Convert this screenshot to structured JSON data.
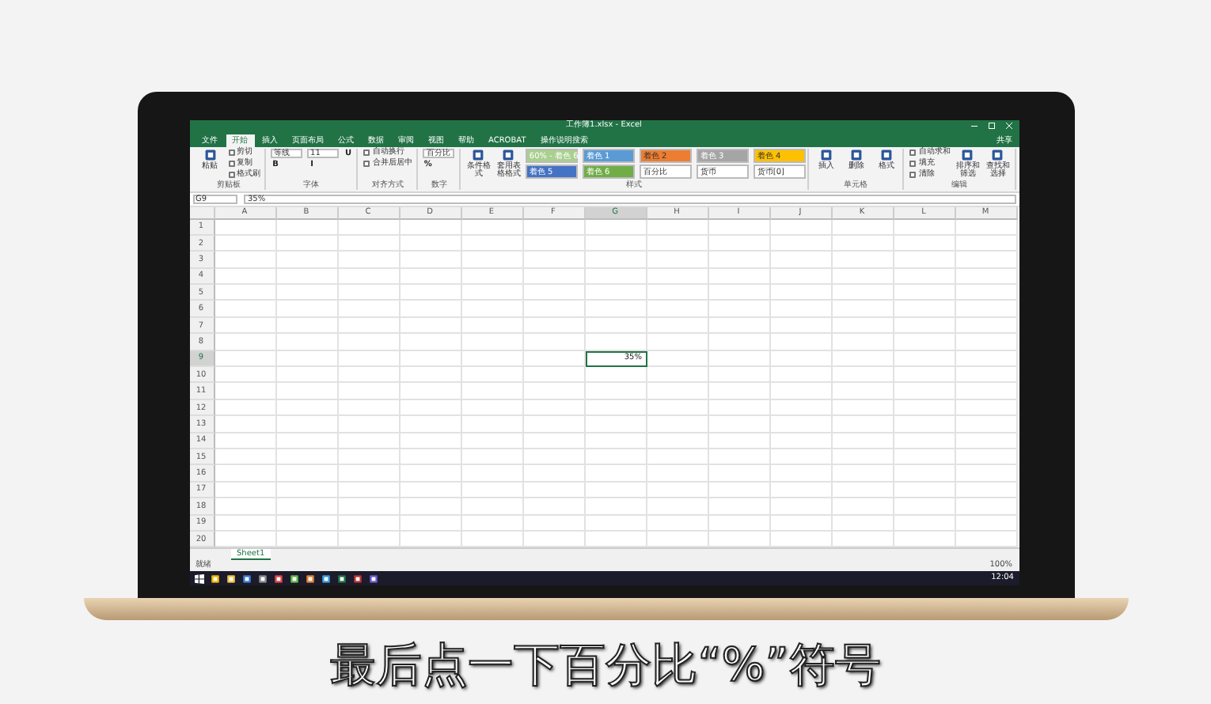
{
  "window": {
    "title": "工作簿1.xlsx - Excel",
    "share": "共享"
  },
  "ribbon_tabs": [
    {
      "label": "文件",
      "selected": false
    },
    {
      "label": "开始",
      "selected": true
    },
    {
      "label": "插入",
      "selected": false
    },
    {
      "label": "页面布局",
      "selected": false
    },
    {
      "label": "公式",
      "selected": false
    },
    {
      "label": "数据",
      "selected": false
    },
    {
      "label": "审阅",
      "selected": false
    },
    {
      "label": "视图",
      "selected": false
    },
    {
      "label": "帮助",
      "selected": false
    },
    {
      "label": "ACROBAT",
      "selected": false
    }
  ],
  "tell_me": "操作说明搜索",
  "ribbon_groups": [
    {
      "label": "剪贴板",
      "items": [
        {
          "kind": "large",
          "label": "粘贴"
        },
        {
          "kind": "small",
          "label": "剪切"
        },
        {
          "kind": "small",
          "label": "复制"
        },
        {
          "kind": "small",
          "label": "格式刷"
        }
      ]
    },
    {
      "label": "字体",
      "items": [
        {
          "kind": "field",
          "label": "等线"
        },
        {
          "kind": "glyph",
          "label": "B"
        },
        {
          "kind": "field",
          "label": "11"
        },
        {
          "kind": "glyph",
          "label": "I"
        },
        {
          "kind": "glyph",
          "label": "U"
        }
      ]
    },
    {
      "label": "对齐方式",
      "items": [
        {
          "kind": "small",
          "label": "自动换行"
        },
        {
          "kind": "small",
          "label": "合并后居中"
        }
      ]
    },
    {
      "label": "数字",
      "items": [
        {
          "kind": "field",
          "label": "百分比"
        },
        {
          "kind": "glyph",
          "label": "%"
        }
      ]
    },
    {
      "label": "样式",
      "items": [
        {
          "kind": "large",
          "label": "条件格式"
        },
        {
          "kind": "large",
          "label": "套用表格格式"
        },
        {
          "kind": "chip",
          "label": "60% - 着色 6",
          "color": "#a9d08e"
        },
        {
          "kind": "chip",
          "label": "着色 5",
          "color": "#4472c4"
        },
        {
          "kind": "chip",
          "label": "着色 1",
          "color": "#5b9bd5"
        },
        {
          "kind": "chip",
          "label": "着色 6",
          "color": "#70ad47"
        },
        {
          "kind": "chip",
          "label": "着色 2",
          "color": "#ed7d31"
        },
        {
          "kind": "chip",
          "label": "百分比",
          "color": "#ffffff"
        },
        {
          "kind": "chip",
          "label": "着色 3",
          "color": "#a5a5a5"
        },
        {
          "kind": "chip",
          "label": "货币",
          "color": "#ffffff"
        },
        {
          "kind": "chip",
          "label": "着色 4",
          "color": "#ffc000"
        },
        {
          "kind": "chip",
          "label": "货币[0]",
          "color": "#ffffff"
        }
      ]
    },
    {
      "label": "单元格",
      "items": [
        {
          "kind": "large",
          "label": "插入"
        },
        {
          "kind": "large",
          "label": "删除"
        },
        {
          "kind": "large",
          "label": "格式"
        }
      ]
    },
    {
      "label": "编辑",
      "items": [
        {
          "kind": "small",
          "label": "自动求和"
        },
        {
          "kind": "small",
          "label": "填充"
        },
        {
          "kind": "small",
          "label": "清除"
        },
        {
          "kind": "large",
          "label": "排序和筛选"
        },
        {
          "kind": "large",
          "label": "查找和选择"
        }
      ]
    }
  ],
  "name_box": "G9",
  "formula": "35%",
  "columns": [
    {
      "label": "A",
      "selected": false
    },
    {
      "label": "B",
      "selected": false
    },
    {
      "label": "C",
      "selected": false
    },
    {
      "label": "D",
      "selected": false
    },
    {
      "label": "E",
      "selected": false
    },
    {
      "label": "F",
      "selected": false
    },
    {
      "label": "G",
      "selected": true
    },
    {
      "label": "H",
      "selected": false
    },
    {
      "label": "I",
      "selected": false
    },
    {
      "label": "J",
      "selected": false
    },
    {
      "label": "K",
      "selected": false
    },
    {
      "label": "L",
      "selected": false
    },
    {
      "label": "M",
      "selected": false
    }
  ],
  "rows": [
    {
      "label": "1",
      "selected": false
    },
    {
      "label": "2",
      "selected": false
    },
    {
      "label": "3",
      "selected": false
    },
    {
      "label": "4",
      "selected": false
    },
    {
      "label": "5",
      "selected": false
    },
    {
      "label": "6",
      "selected": false
    },
    {
      "label": "7",
      "selected": false
    },
    {
      "label": "8",
      "selected": false
    },
    {
      "label": "9",
      "selected": true
    },
    {
      "label": "10",
      "selected": false
    },
    {
      "label": "11",
      "selected": false
    },
    {
      "label": "12",
      "selected": false
    },
    {
      "label": "13",
      "selected": false
    },
    {
      "label": "14",
      "selected": false
    },
    {
      "label": "15",
      "selected": false
    },
    {
      "label": "16",
      "selected": false
    },
    {
      "label": "17",
      "selected": false
    },
    {
      "label": "18",
      "selected": false
    },
    {
      "label": "19",
      "selected": false
    },
    {
      "label": "20",
      "selected": false
    }
  ],
  "active_cell_value": "35%",
  "sheet_tabs": [
    {
      "label": "Sheet1",
      "selected": true
    }
  ],
  "status_bar": {
    "state": "就绪",
    "zoom": "100%"
  },
  "taskbar": {
    "time": "12:04"
  },
  "caption": "最后点一下百分比“%”符号"
}
